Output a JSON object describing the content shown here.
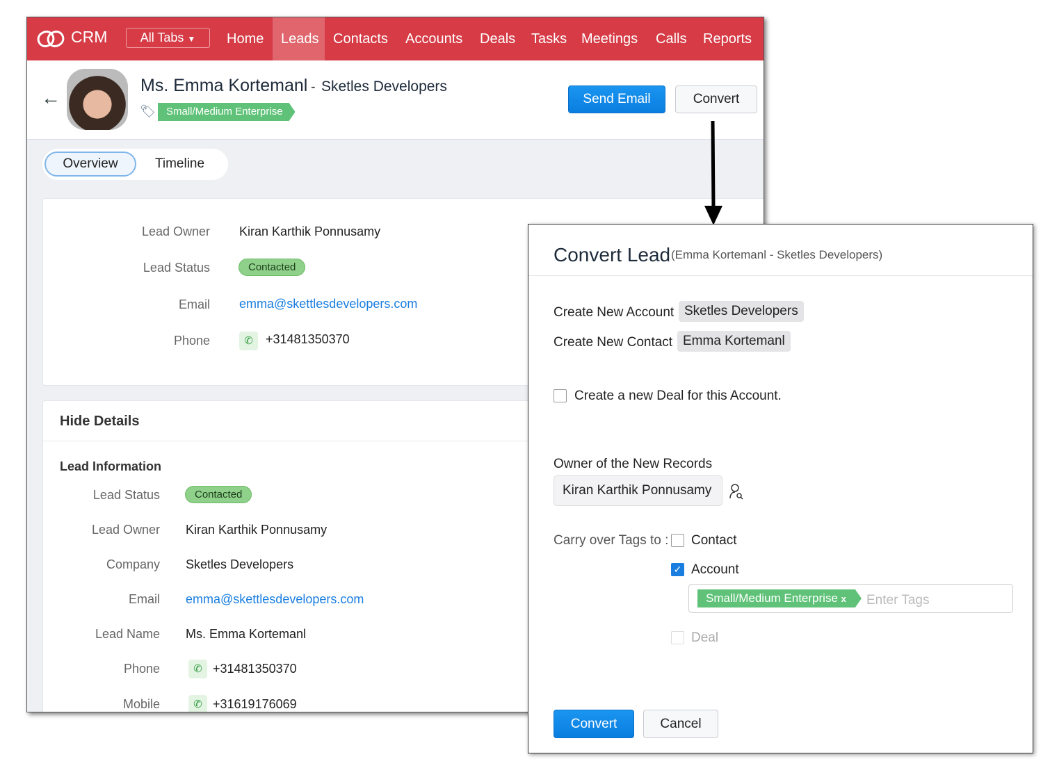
{
  "nav": {
    "logo": "CRM",
    "all_tabs": "All Tabs",
    "items": [
      "Home",
      "Leads",
      "Contacts",
      "Accounts",
      "Deals",
      "Tasks",
      "Meetings",
      "Calls",
      "Reports"
    ],
    "active": "Leads"
  },
  "lead": {
    "name": "Ms. Emma Kortemanl",
    "separator": "-",
    "company": "Sketles Developers",
    "tag": "Small/Medium Enterprise"
  },
  "actions": {
    "send_email": "Send Email",
    "convert": "Convert"
  },
  "tabs": [
    "Overview",
    "Timeline"
  ],
  "overview": [
    {
      "label": "Lead Owner",
      "value": "Kiran Karthik Ponnusamy"
    },
    {
      "label": "Lead Status",
      "value": "Contacted"
    },
    {
      "label": "Email",
      "value": "emma@skettlesdevelopers.com"
    },
    {
      "label": "Phone",
      "value": "+31481350370"
    }
  ],
  "details": {
    "toggle": "Hide Details",
    "section": "Lead Information",
    "fields": [
      {
        "label": "Lead Status",
        "value": "Contacted"
      },
      {
        "label": "Lead Owner",
        "value": "Kiran Karthik Ponnusamy"
      },
      {
        "label": "Company",
        "value": "Sketles Developers"
      },
      {
        "label": "Email",
        "value": "emma@skettlesdevelopers.com"
      },
      {
        "label": "Lead Name",
        "value": "Ms. Emma Kortemanl"
      },
      {
        "label": "Phone",
        "value": "+31481350370"
      },
      {
        "label": "Mobile",
        "value": "+31619176069"
      }
    ]
  },
  "modal": {
    "title": "Convert Lead",
    "subtitle": "(Emma Kortemanl - Sketles Developers)",
    "account_label": "Create New Account",
    "account_value": "Sketles Developers",
    "contact_label": "Create New Contact",
    "contact_value": "Emma Kortemanl",
    "deal_checkbox": "Create a new Deal for this Account.",
    "deal_checked": false,
    "owner_label": "Owner of the New Records",
    "owner_value": "Kiran Karthik Ponnusamy",
    "carry_label": "Carry over Tags to :",
    "carry": [
      {
        "label": "Contact",
        "checked": false
      },
      {
        "label": "Account",
        "checked": true
      },
      {
        "label": "Deal",
        "checked": false,
        "disabled": true
      }
    ],
    "tag": "Small/Medium Enterprise",
    "tag_remove": "x",
    "tags_placeholder": "Enter Tags",
    "convert": "Convert",
    "cancel": "Cancel"
  },
  "colors": {
    "nav": "#d63b46",
    "primary": "#0a7ee0",
    "tag": "#5fc278",
    "status": "#8fd18a"
  }
}
